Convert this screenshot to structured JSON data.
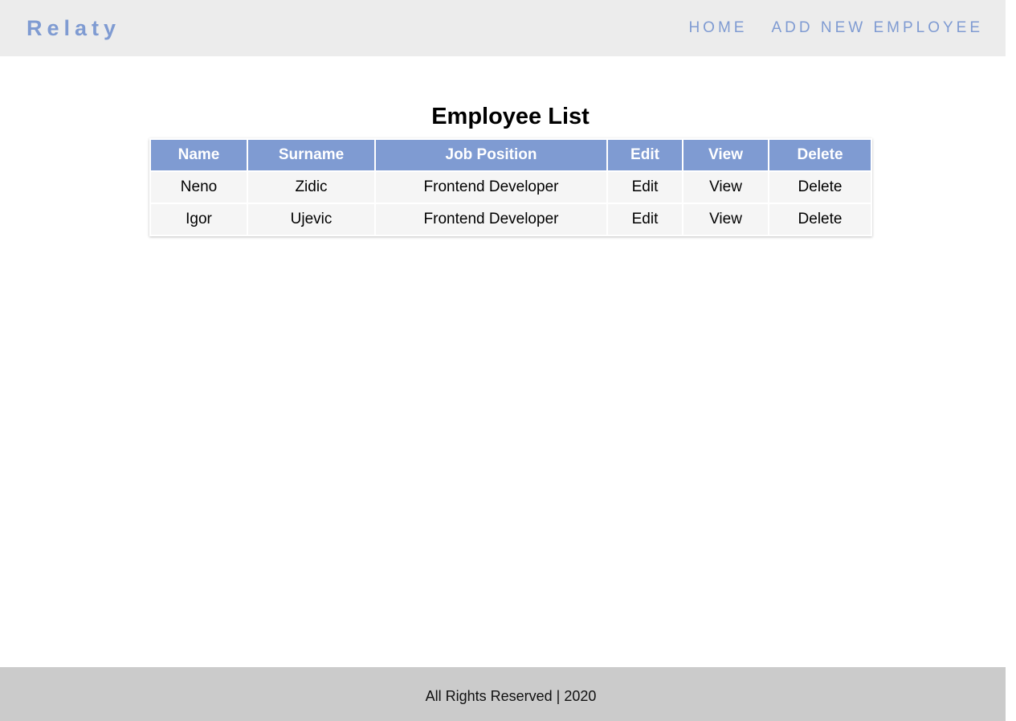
{
  "navbar": {
    "brand": "Relaty",
    "links": [
      {
        "label": "HOME"
      },
      {
        "label": "ADD NEW EMPLOYEE"
      }
    ]
  },
  "main": {
    "title": "Employee List",
    "table": {
      "headers": [
        "Name",
        "Surname",
        "Job Position",
        "Edit",
        "View",
        "Delete"
      ],
      "rows": [
        {
          "name": "Neno",
          "surname": "Zidic",
          "job": "Frontend Developer",
          "edit": "Edit",
          "view": "View",
          "delete": "Delete"
        },
        {
          "name": "Igor",
          "surname": "Ujevic",
          "job": "Frontend Developer",
          "edit": "Edit",
          "view": "View",
          "delete": "Delete"
        }
      ]
    }
  },
  "footer": {
    "text": "All Rights Reserved | 2020"
  },
  "colors": {
    "accent": "#7f9bd2",
    "navbar_bg": "#ececec",
    "footer_bg": "#cbcbcb",
    "row_bg": "#f5f5f5"
  }
}
